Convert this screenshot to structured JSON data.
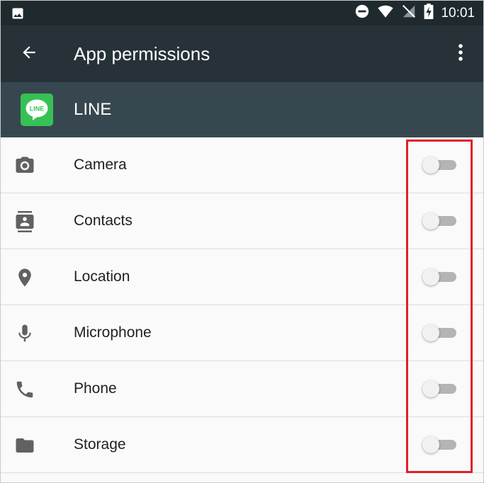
{
  "status_bar": {
    "time": "10:01",
    "icons": [
      "image-icon",
      "do-not-disturb-icon",
      "wifi-icon",
      "no-sim-icon",
      "battery-charging-icon"
    ]
  },
  "toolbar": {
    "title": "App permissions",
    "back_icon": "arrow-back-icon",
    "overflow_icon": "more-vert-icon"
  },
  "app": {
    "name": "LINE",
    "logo_text": "LINE",
    "logo_color": "#37c155"
  },
  "permissions": [
    {
      "label": "Camera",
      "icon": "camera-icon",
      "enabled": false
    },
    {
      "label": "Contacts",
      "icon": "contacts-icon",
      "enabled": false
    },
    {
      "label": "Location",
      "icon": "location-icon",
      "enabled": false
    },
    {
      "label": "Microphone",
      "icon": "microphone-icon",
      "enabled": false
    },
    {
      "label": "Phone",
      "icon": "phone-icon",
      "enabled": false
    },
    {
      "label": "Storage",
      "icon": "folder-icon",
      "enabled": false
    }
  ],
  "colors": {
    "status_bar": "#1f2a2f",
    "toolbar": "#263238",
    "app_header": "#37474f",
    "highlight": "#e0202a",
    "icon_gray": "#616161"
  }
}
